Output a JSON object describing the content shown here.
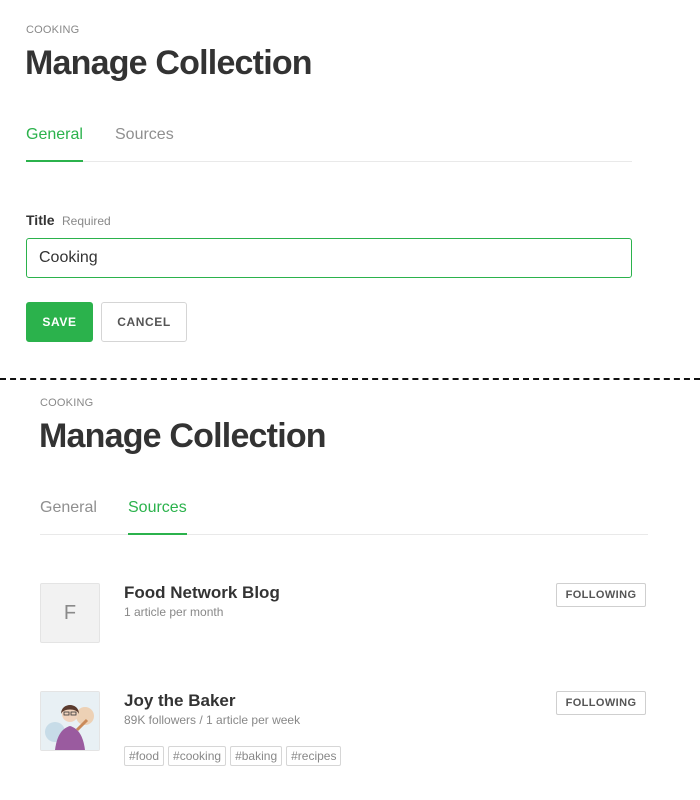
{
  "top_panel": {
    "eyebrow": "COOKING",
    "title": "Manage Collection",
    "tabs": [
      {
        "label": "General",
        "active": true
      },
      {
        "label": "Sources",
        "active": false
      }
    ],
    "form": {
      "title_label": "Title",
      "title_hint": "Required",
      "title_value": "Cooking"
    },
    "buttons": {
      "save_label": "SAVE",
      "cancel_label": "CANCEL"
    }
  },
  "bottom_panel": {
    "eyebrow": "COOKING",
    "title": "Manage Collection",
    "tabs": [
      {
        "label": "General",
        "active": false
      },
      {
        "label": "Sources",
        "active": true
      }
    ],
    "sources": [
      {
        "thumb_letter": "F",
        "name": "Food Network Blog",
        "meta": "1 article per month",
        "follow_label": "FOLLOWING",
        "tags": []
      },
      {
        "thumb_icon": "person-avatar-icon",
        "name": "Joy the Baker",
        "meta": "89K followers / 1 article per week",
        "follow_label": "FOLLOWING",
        "tags": [
          "#food",
          "#cooking",
          "#baking",
          "#recipes"
        ]
      }
    ]
  },
  "colors": {
    "accent": "#2bb24c",
    "text": "#333333",
    "muted": "#888888",
    "border": "#e9e9e9"
  }
}
